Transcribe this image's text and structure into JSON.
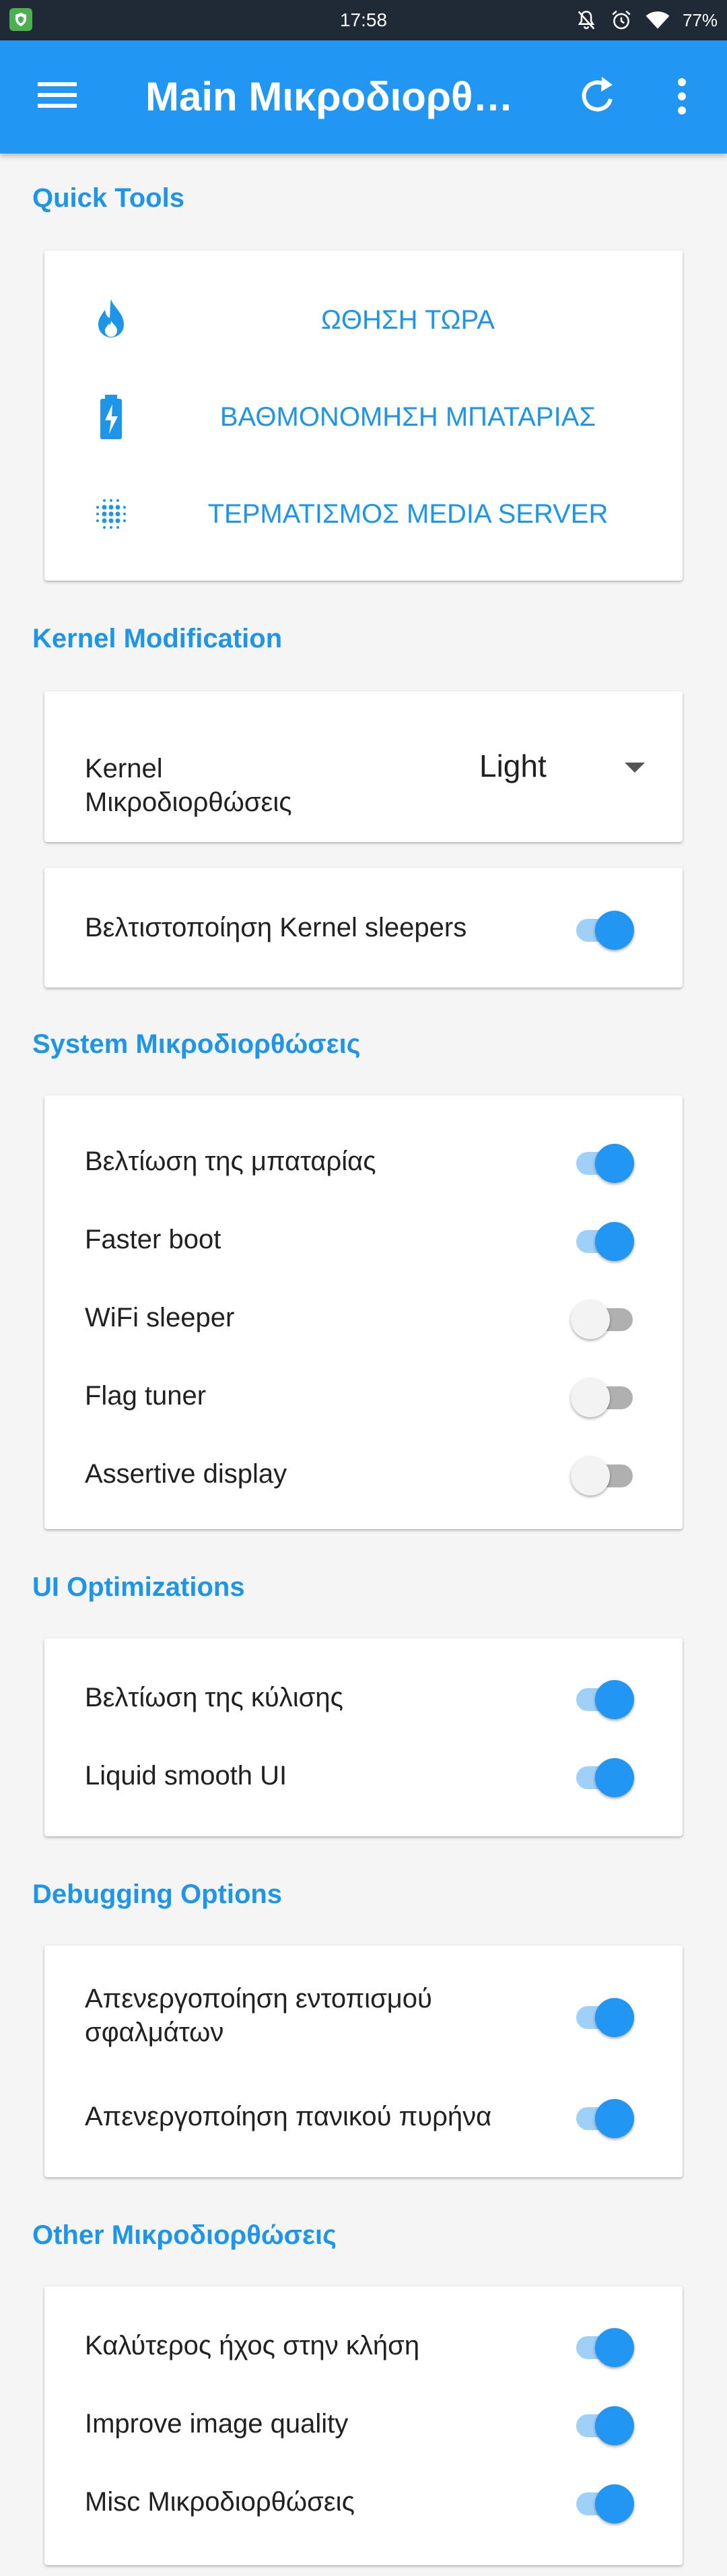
{
  "status_bar": {
    "time": "17:58",
    "battery": "77%",
    "icons": [
      "shield-icon",
      "notifications-off-icon",
      "alarm-icon",
      "wifi-icon"
    ]
  },
  "app_bar": {
    "title": "Main Μικροδιορθώσεις",
    "icons": [
      "menu-icon",
      "refresh-icon",
      "more-vert-icon"
    ]
  },
  "colors": {
    "primary": "#2196f3",
    "accent_text": "#1e95e6",
    "status_bar": "#1f2a36",
    "background": "#f5f5f5",
    "switch_off": "#b0b0b0"
  },
  "quick_tools": {
    "title": "Quick Tools",
    "items": [
      {
        "label": "ΩΘΗΣΗ ΤΩΡΑ",
        "icon": "fire-icon"
      },
      {
        "label": "ΒΑΘΜΟΝΟΜΗΣΗ ΜΠΑΤΑΡΙΑΣ",
        "icon": "battery-charging-icon"
      },
      {
        "label": "ΤΕΡΜΑΤΙΣΜΟΣ MEDIA SERVER",
        "icon": "dots-grid-icon"
      }
    ]
  },
  "kernel": {
    "title": "Kernel Modification",
    "tweaks_label_1": "Kernel",
    "tweaks_label_2": "Μικροδιορθώσεις",
    "tweaks_value": "Light",
    "sleepers_label": "Βελτιστοποίηση Kernel sleepers",
    "sleepers_on": true
  },
  "system": {
    "title": "System Μικροδιορθώσεις",
    "items": [
      {
        "label": "Βελτίωση της μπαταρίας",
        "on": true
      },
      {
        "label": "Faster boot",
        "on": true
      },
      {
        "label": "WiFi sleeper",
        "on": false
      },
      {
        "label": "Flag tuner",
        "on": false
      },
      {
        "label": "Assertive display",
        "on": false
      }
    ]
  },
  "ui": {
    "title": "UI Optimizations",
    "items": [
      {
        "label": "Βελτίωση της κύλισης",
        "on": true
      },
      {
        "label": "Liquid smooth UI",
        "on": true
      }
    ]
  },
  "debugging": {
    "title": "Debugging Options",
    "items": [
      {
        "label_1": "Απενεργοποίηση εντοπισμού",
        "label_2": "σφαλμάτων",
        "on": true
      },
      {
        "label_1": "Απενεργοποίηση πανικού πυρήνα",
        "on": true
      }
    ]
  },
  "other": {
    "title": "Other Μικροδιορθώσεις",
    "items": [
      {
        "label": "Καλύτερος ήχος στην κλήση",
        "on": true
      },
      {
        "label": "Improve image quality",
        "on": true
      },
      {
        "label": "Misc Μικροδιορθώσεις",
        "on": true
      }
    ]
  }
}
